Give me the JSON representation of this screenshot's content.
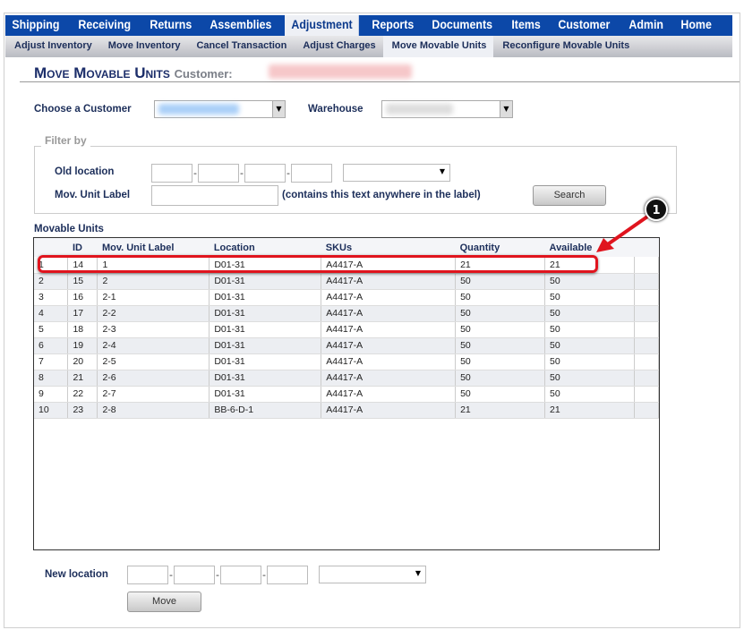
{
  "nav": {
    "items": [
      "Shipping",
      "Receiving",
      "Returns",
      "Assemblies",
      "Adjustment",
      "Reports",
      "Documents",
      "Items",
      "Customer",
      "Admin",
      "Home"
    ],
    "active": "Adjustment"
  },
  "subnav": {
    "items": [
      "Adjust Inventory",
      "Move Inventory",
      "Cancel Transaction",
      "Adjust Charges",
      "Move Movable Units",
      "Reconfigure Movable Units"
    ],
    "active": "Move Movable Units"
  },
  "page": {
    "title": "Move Movable Units",
    "customer_label": "Customer:"
  },
  "form": {
    "choose_customer": "Choose a Customer",
    "warehouse": "Warehouse",
    "filter_legend": "Filter by",
    "old_location": "Old location",
    "mov_unit_label": "Mov. Unit Label",
    "contains_hint": "(contains this text anywhere in the label)",
    "search": "Search",
    "new_location": "New location",
    "move": "Move"
  },
  "grid": {
    "title": "Movable Units",
    "columns": [
      "",
      "ID",
      "Mov. Unit Label",
      "Location",
      "SKUs",
      "Quantity",
      "Available"
    ],
    "rows": [
      [
        "1",
        "14",
        "1",
        "D01-31",
        "A4417-A",
        "21",
        "21"
      ],
      [
        "2",
        "15",
        "2",
        "D01-31",
        "A4417-A",
        "50",
        "50"
      ],
      [
        "3",
        "16",
        "2-1",
        "D01-31",
        "A4417-A",
        "50",
        "50"
      ],
      [
        "4",
        "17",
        "2-2",
        "D01-31",
        "A4417-A",
        "50",
        "50"
      ],
      [
        "5",
        "18",
        "2-3",
        "D01-31",
        "A4417-A",
        "50",
        "50"
      ],
      [
        "6",
        "19",
        "2-4",
        "D01-31",
        "A4417-A",
        "50",
        "50"
      ],
      [
        "7",
        "20",
        "2-5",
        "D01-31",
        "A4417-A",
        "50",
        "50"
      ],
      [
        "8",
        "21",
        "2-6",
        "D01-31",
        "A4417-A",
        "50",
        "50"
      ],
      [
        "9",
        "22",
        "2-7",
        "D01-31",
        "A4417-A",
        "50",
        "50"
      ],
      [
        "10",
        "23",
        "2-8",
        "BB-6-D-1",
        "A4417-A",
        "21",
        "21"
      ]
    ]
  },
  "annotation": {
    "badge": "1",
    "color": "#e0141e"
  }
}
